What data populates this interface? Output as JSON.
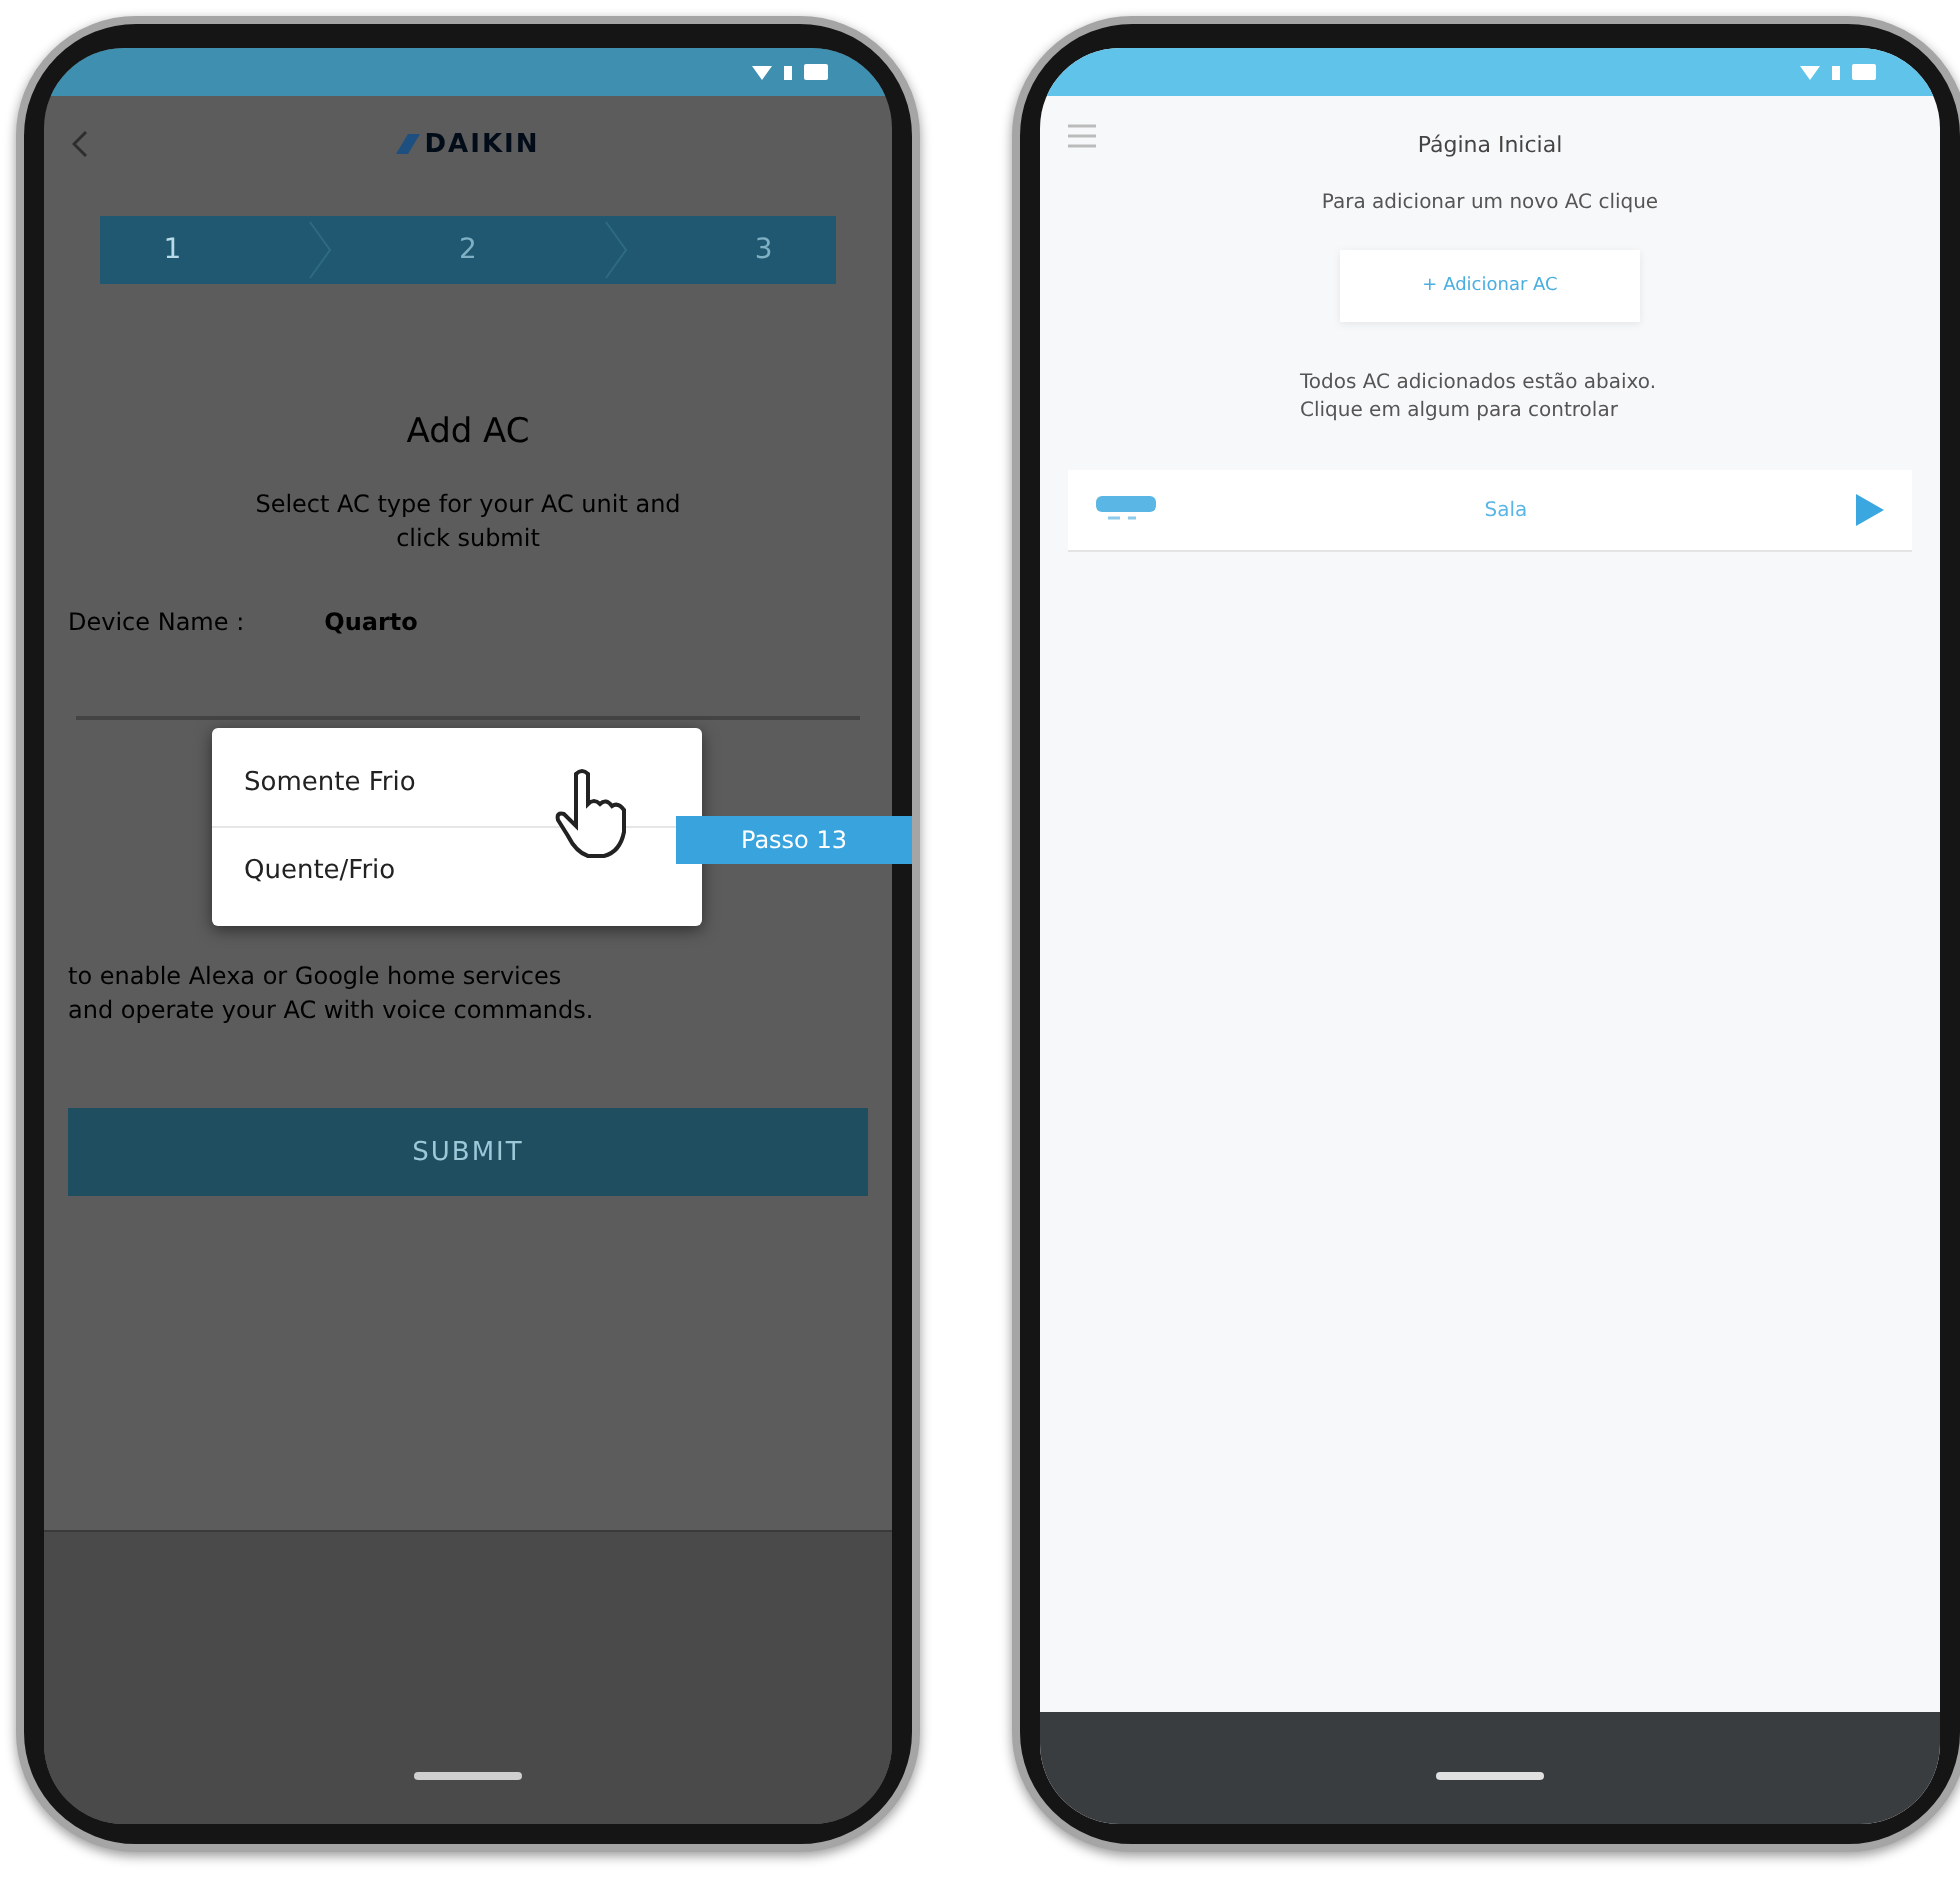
{
  "left_screen": {
    "logo": "DAIKIN",
    "steps": [
      {
        "label": "1",
        "selected": true
      },
      {
        "label": "2",
        "selected": false
      },
      {
        "label": "3",
        "selected": false
      }
    ],
    "title": "Add AC",
    "instructions": "Select AC type for your AC unit and click submit",
    "device_label": "Device Name :",
    "device_value": "Quarto",
    "note_lines": [
      "to enable Alexa or Google home services",
      "and operate your AC with voice commands."
    ],
    "submit": "SUBMIT",
    "dropdown": {
      "options": [
        "Somente Frio",
        "Quente/Frio"
      ]
    },
    "tooltip": "Passo 13"
  },
  "right_screen": {
    "title": "Página Inicial",
    "add_prompt": "Para adicionar um novo AC clique",
    "add_button": "+ Adicionar AC",
    "list_hint": "Todos AC adicionados estão abaixo. Clique em algum para controlar",
    "devices": [
      {
        "name": "Sala"
      }
    ]
  }
}
